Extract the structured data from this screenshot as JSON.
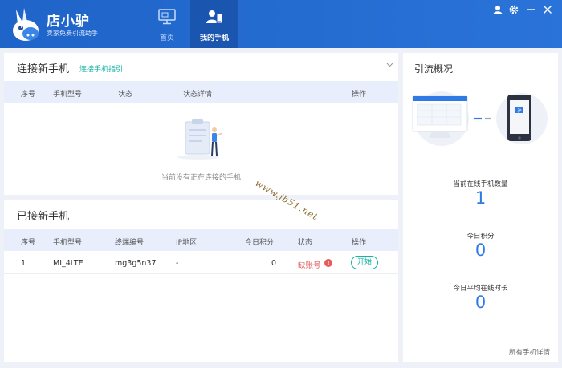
{
  "header": {
    "brand_name": "店小驴",
    "brand_slogan": "卖家免费引流助手",
    "nav": [
      {
        "label": "首页",
        "icon": "monitor-icon",
        "active": false
      },
      {
        "label": "我的手机",
        "icon": "user-phone-icon",
        "active": true
      }
    ],
    "window_controls": [
      "user-icon",
      "gear-icon",
      "minimize-icon",
      "close-icon"
    ]
  },
  "connect_panel": {
    "title": "连接新手机",
    "guide_link": "连接手机指引",
    "columns": [
      "序号",
      "手机型号",
      "状态",
      "状态详情",
      "操作"
    ],
    "empty_text": "当前没有正在连接的手机"
  },
  "connected_panel": {
    "title": "已接新手机",
    "columns": [
      "序号",
      "手机型号",
      "终端编号",
      "IP地区",
      "今日积分",
      "状态",
      "操作"
    ],
    "rows": [
      {
        "index": "1",
        "model": "MI_4LTE",
        "terminal_id": "mg3g5n37",
        "ip_region": "-",
        "points": "0",
        "status": "缺账号",
        "action": "开始"
      }
    ]
  },
  "overview_panel": {
    "title": "引流概况",
    "stats": [
      {
        "label": "当前在线手机数量",
        "value": "1"
      },
      {
        "label": "今日积分",
        "value": "0"
      },
      {
        "label": "今日平均在线时长",
        "value": "0"
      }
    ],
    "details_link": "所有手机详情"
  },
  "watermark": "www.jb51.net",
  "colors": {
    "header": "#2a6fd6",
    "accent": "#17b3a3",
    "value": "#2f7ae5",
    "warning": "#e05d5d"
  }
}
